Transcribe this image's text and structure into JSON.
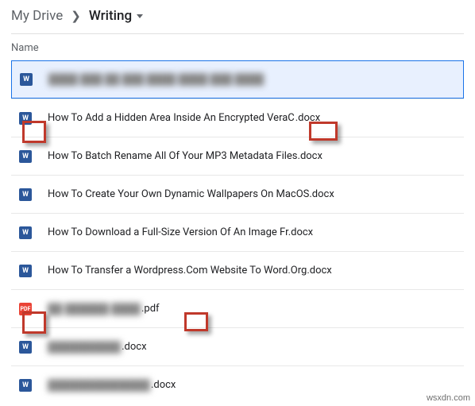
{
  "breadcrumb": {
    "root": "My Drive",
    "folder": "Writing"
  },
  "columns": {
    "name": "Name"
  },
  "rows": [
    {
      "type": "word",
      "blur": true,
      "prefix": "████ ███ ██ ███ ████ ████ ███ ████",
      "ext": ""
    },
    {
      "type": "word",
      "blur": false,
      "prefix": "How To Add a Hidden Area Inside An Encrypted VeraC",
      "ext": ".docx"
    },
    {
      "type": "word",
      "blur": false,
      "prefix": "How To Batch Rename All Of Your MP3 Metadata Files.docx",
      "ext": ""
    },
    {
      "type": "word",
      "blur": false,
      "prefix": "How To Create Your Own Dynamic Wallpapers On MacOS.docx",
      "ext": ""
    },
    {
      "type": "word",
      "blur": false,
      "prefix": "How To Download a Full-Size Version Of An Image Fr.docx",
      "ext": ""
    },
    {
      "type": "word",
      "blur": false,
      "prefix": "How To Transfer a Wordpress.Com Website To Word.Org.docx",
      "ext": ""
    },
    {
      "type": "pdf",
      "blur": true,
      "prefix": "██ ██████ ████",
      "ext": ".pdf"
    },
    {
      "type": "word",
      "blur": true,
      "prefix": "██████████",
      "ext": ".docx"
    },
    {
      "type": "word",
      "blur": true,
      "prefix": "██████████████",
      "ext": ".docx"
    }
  ],
  "icon_glyph": {
    "word": "W",
    "pdf": "PDF"
  },
  "watermark": "wsxdn.com"
}
